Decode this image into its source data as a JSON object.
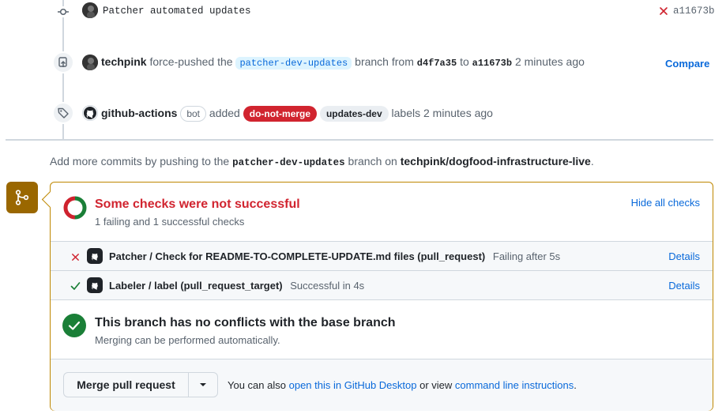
{
  "timeline": {
    "commit": {
      "message": "Patcher automated updates",
      "status_icon": "x-icon",
      "sha": "a11673b"
    },
    "force_push": {
      "actor": "techpink",
      "action": "force-pushed the",
      "branch": "patcher-dev-updates",
      "from_word": "branch from",
      "from_sha": "d4f7a35",
      "to_word": "to",
      "to_sha": "a11673b",
      "time": "2 minutes ago",
      "compare_label": "Compare"
    },
    "labels_event": {
      "actor": "github-actions",
      "bot_label": "bot",
      "action": "added",
      "labels": [
        "do-not-merge",
        "updates-dev"
      ],
      "suffix": "labels 2 minutes ago"
    }
  },
  "push_hint": {
    "prefix": "Add more commits by pushing to the",
    "branch": "patcher-dev-updates",
    "middle": "branch on",
    "repo": "techpink/dogfood-infrastructure-live",
    "suffix": "."
  },
  "checks": {
    "title": "Some checks were not successful",
    "subtitle": "1 failing and 1 successful checks",
    "hide_label": "Hide all checks",
    "items": [
      {
        "status": "failure",
        "name": "Patcher / Check for README-TO-COMPLETE-UPDATE.md files (pull_request)",
        "detail": "Failing after 5s",
        "link": "Details"
      },
      {
        "status": "success",
        "name": "Labeler / label (pull_request_target)",
        "detail": "Successful in 4s",
        "link": "Details"
      }
    ]
  },
  "conflicts": {
    "title": "This branch has no conflicts with the base branch",
    "subtitle": "Merging can be performed automatically."
  },
  "merge": {
    "button_label": "Merge pull request",
    "text_prefix": "You can also",
    "desktop_link": "open this in GitHub Desktop",
    "text_middle": "or view",
    "cli_link": "command line instructions",
    "text_suffix": "."
  },
  "colors": {
    "fail": "#cf222e",
    "success": "#1a7f37",
    "warn_border": "#bf8700",
    "merge_icon_bg": "#9a6700",
    "link": "#0969da"
  }
}
